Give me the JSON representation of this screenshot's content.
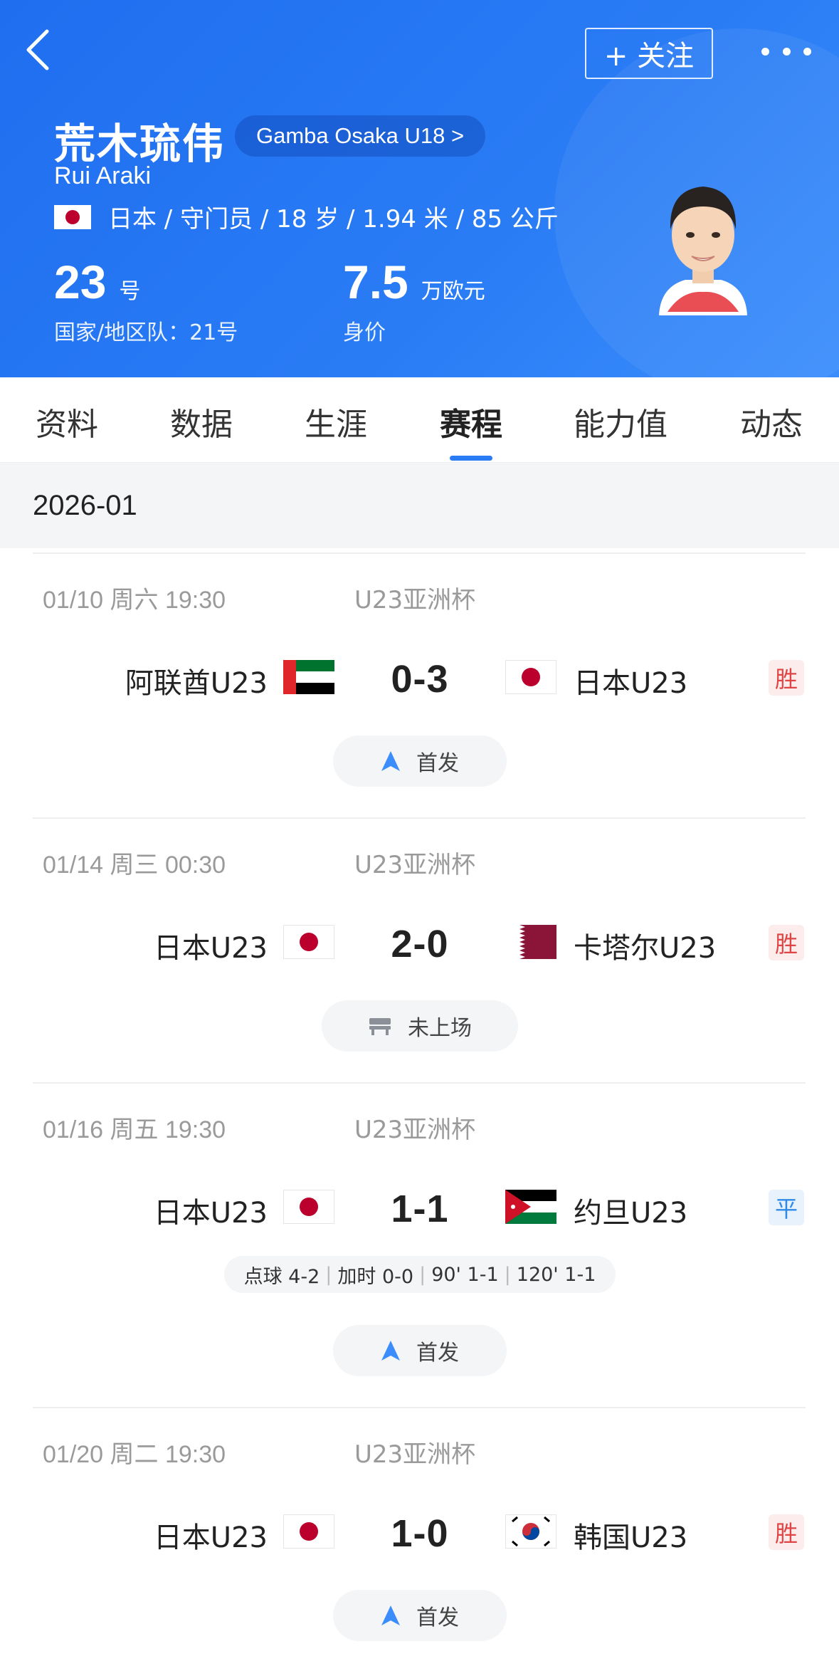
{
  "header": {
    "follow_label": "+ 关注",
    "name_cn": "荒木琉伟",
    "name_en": "Rui Araki",
    "team_link": "Gamba Osaka U18 >",
    "info": "日本 / 守门员 / 18 岁 / 1.94 米 / 85 公斤",
    "shirt_number": "23",
    "shirt_unit": "号",
    "national_team": "国家/地区队：21号",
    "market_value": "7.5",
    "market_value_unit": "万欧元",
    "market_value_label": "身价"
  },
  "tabs": [
    {
      "label": "资料"
    },
    {
      "label": "数据"
    },
    {
      "label": "生涯"
    },
    {
      "label": "赛程",
      "active": true
    },
    {
      "label": "能力值"
    },
    {
      "label": "动态"
    }
  ],
  "month": "2026-01",
  "matches": [
    {
      "date": "01/10  周六 19:30",
      "competition": "U23亚洲杯",
      "home": "阿联酋U23",
      "home_flag": "uae-flag",
      "score": "0-3",
      "away": "日本U23",
      "away_flag": "japan-flag",
      "result": "胜",
      "status": "首发",
      "status_icon": "lineup-arrow-icon"
    },
    {
      "date": "01/14  周三 00:30",
      "competition": "U23亚洲杯",
      "home": "日本U23",
      "home_flag": "japan-flag",
      "score": "2-0",
      "away": "卡塔尔U23",
      "away_flag": "qatar-flag",
      "result": "胜",
      "status": "未上场",
      "status_icon": "bench-icon"
    },
    {
      "date": "01/16  周五 19:30",
      "competition": "U23亚洲杯",
      "home": "日本U23",
      "home_flag": "japan-flag",
      "score": "1-1",
      "away": "约旦U23",
      "away_flag": "jordan-flag",
      "result": "平",
      "extra": [
        "点球 4-2",
        "加时 0-0",
        "90' 1-1",
        "120' 1-1"
      ],
      "status": "首发",
      "status_icon": "lineup-arrow-icon"
    },
    {
      "date": "01/20  周二 19:30",
      "competition": "U23亚洲杯",
      "home": "日本U23",
      "home_flag": "japan-flag",
      "score": "1-0",
      "away": "韩国U23",
      "away_flag": "korea-flag",
      "result": "胜",
      "status": "首发",
      "status_icon": "lineup-arrow-icon"
    }
  ],
  "colors": {
    "header_blue": "#2a7cf5",
    "win_red": "#e04545",
    "draw_blue": "#2f8ae6"
  }
}
